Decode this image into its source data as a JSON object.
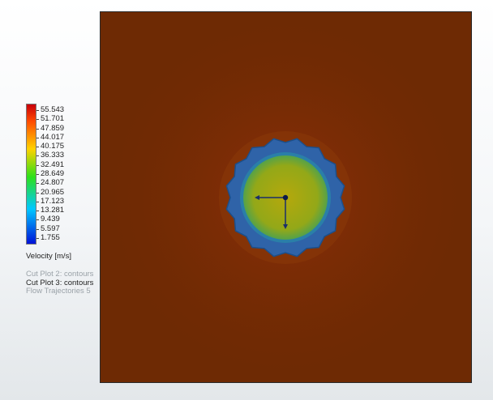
{
  "legend": {
    "ticks": [
      "55.543",
      "51.701",
      "47.859",
      "44.017",
      "40.175",
      "36.333",
      "32.491",
      "28.649",
      "24.807",
      "20.965",
      "17.123",
      "13.281",
      "9.439",
      "5.597",
      "1.755"
    ],
    "quantity_label": "Velocity [m/s]",
    "colors": {
      "top": "#c8000a",
      "upper": "#ff4a00",
      "mid_upper": "#ffd200",
      "mid": "#2ee01a",
      "lower": "#00c8ff",
      "bottom": "#0012d8"
    }
  },
  "plots": [
    {
      "label": "Cut Plot 2: contours",
      "state": "inactive"
    },
    {
      "label": "Cut Plot 3: contours",
      "state": "active"
    },
    {
      "label": "Flow Trajectories 5",
      "state": "inactive"
    }
  ],
  "view": {
    "field_color": "#6e2a04",
    "triad_icon": "coordinate-triad-icon"
  }
}
